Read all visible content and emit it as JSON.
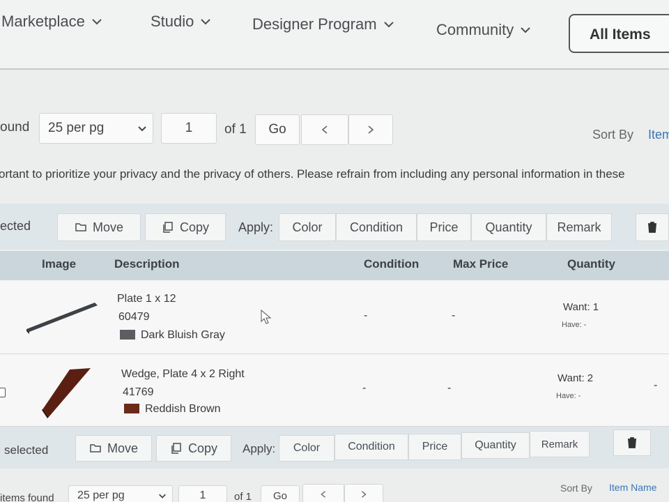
{
  "nav": {
    "items": [
      "Marketplace",
      "Studio",
      "Designer Program",
      "Community"
    ],
    "all_items": "All Items"
  },
  "pager_top": {
    "found_label": "ound",
    "per_page": "25 per pg",
    "page": "1",
    "of": "of 1",
    "go": "Go",
    "sort_by": "Sort By",
    "sort_value": "Item"
  },
  "privacy_text": "ortant to prioritize your privacy and the privacy of others. Please refrain from including any personal information in these",
  "toolbar_top": {
    "selected": "ected",
    "move": "Move",
    "copy": "Copy",
    "apply": "Apply:",
    "color": "Color",
    "condition": "Condition",
    "price": "Price",
    "quantity": "Quantity",
    "remark": "Remark"
  },
  "table": {
    "headers": {
      "image": "Image",
      "description": "Description",
      "condition": "Condition",
      "max_price": "Max Price",
      "quantity": "Quantity"
    },
    "rows": [
      {
        "name": "Plate 1 x 12",
        "part": "60479",
        "color": "Dark Bluish Gray",
        "color_hex": "#5b5f63",
        "condition": "-",
        "max_price": "-",
        "want": "Want: 1",
        "have": "Have: -"
      },
      {
        "name": "Wedge, Plate 4 x 2 Right",
        "part": "41769",
        "color": "Reddish Brown",
        "color_hex": "#6b2b1a",
        "condition": "-",
        "max_price": "-",
        "want": "Want: 2",
        "have": "Have: -",
        "extra": "-"
      }
    ]
  },
  "toolbar_bottom": {
    "selected": "selected",
    "move": "Move",
    "copy": "Copy",
    "apply": "Apply:",
    "color": "Color",
    "condition": "Condition",
    "price": "Price",
    "quantity": "Quantity",
    "remark": "Remark"
  },
  "pager_bottom": {
    "found_label": "items found",
    "per_page": "25 per pg",
    "page": "1",
    "of": "of 1",
    "go": "Go",
    "sort_by": "Sort By",
    "sort_value": "Item Name"
  },
  "colors": {
    "link": "#3b74b3",
    "toolbar": "#dfe6ea",
    "header": "#cbd5dc"
  }
}
